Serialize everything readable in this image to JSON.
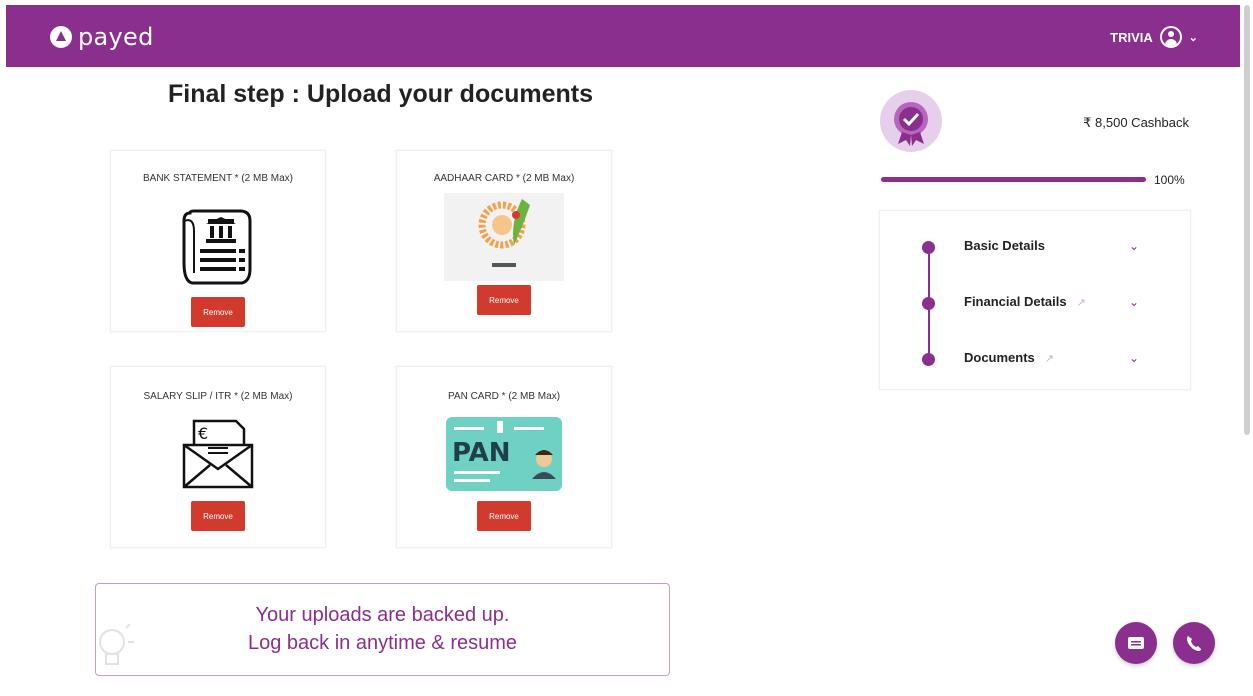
{
  "header": {
    "brand": "payed",
    "user_name": "TRIVIA",
    "user_caret": "⌄",
    "brand_color": "#8a2f8d"
  },
  "main": {
    "title": "Final step : Upload your documents",
    "documents": [
      {
        "label": "BANK STATEMENT * (2 MB Max)",
        "icon": "bank-statement-icon",
        "button": "Remove"
      },
      {
        "label": "AADHAAR CARD * (2 MB Max)",
        "icon": "aadhaar-logo",
        "button": "Remove"
      },
      {
        "label": "SALARY SLIP / ITR * (2 MB Max)",
        "icon": "salary-envelope-icon",
        "button": "Remove"
      },
      {
        "label": "PAN CARD * (2 MB Max)",
        "icon": "pan-card-icon",
        "button": "Remove"
      }
    ],
    "backup_banner": {
      "line1": "Your uploads are backed up.",
      "line2": "Log back in anytime & resume"
    }
  },
  "sidebar": {
    "cashback": "₹ 8,500 Cashback",
    "progress_text": "100%",
    "progress_fraction": 1.0,
    "steps": [
      {
        "label": "Basic Details",
        "editable": false
      },
      {
        "label": "Financial Details",
        "editable": true
      },
      {
        "label": "Documents",
        "editable": true
      }
    ],
    "step_chevron": "⌄",
    "edit_glyph": "↗"
  },
  "fabs": [
    "chat-icon",
    "phone-icon"
  ],
  "colors": {
    "accent": "#8a2f8d",
    "remove": "#d13a2c",
    "pan_card": "#6fd0c4"
  }
}
